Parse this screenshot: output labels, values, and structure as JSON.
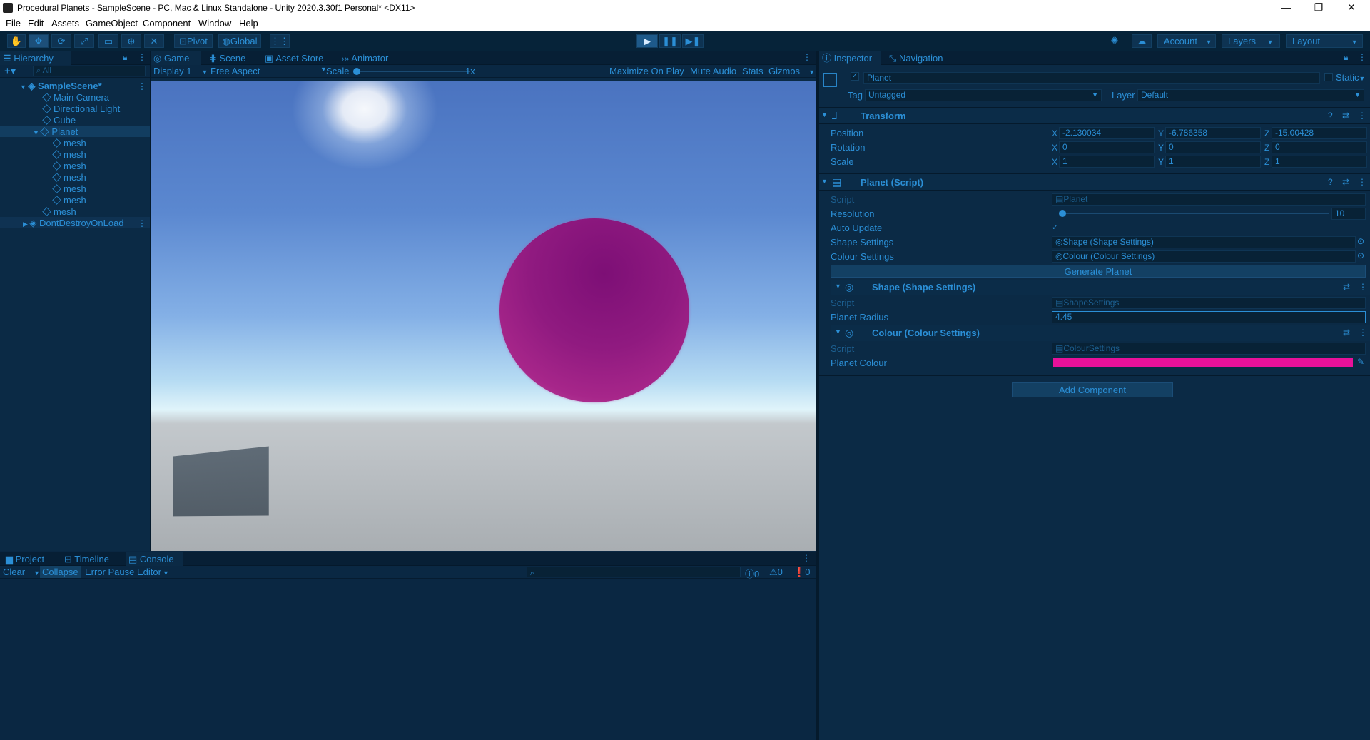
{
  "window": {
    "title": "Procedural Planets - SampleScene - PC, Mac & Linux Standalone - Unity 2020.3.30f1 Personal* <DX11>",
    "minimize": "—",
    "maximize": "❐",
    "close": "✕"
  },
  "menu": [
    "File",
    "Edit",
    "Assets",
    "GameObject",
    "Component",
    "Window",
    "Help"
  ],
  "toolbar": {
    "pivot": "Pivot",
    "global": "Global",
    "account": "Account",
    "layers": "Layers",
    "layout": "Layout"
  },
  "hierarchy": {
    "tab": "Hierarchy",
    "search_placeholder": "All",
    "scene": "SampleScene*",
    "items": [
      "Main Camera",
      "Directional Light",
      "Cube",
      "Planet",
      "mesh",
      "mesh",
      "mesh",
      "mesh",
      "mesh",
      "mesh",
      "mesh",
      "DontDestroyOnLoad"
    ]
  },
  "game": {
    "tabs": [
      "Game",
      "Scene",
      "Asset Store",
      "Animator"
    ],
    "display": "Display 1",
    "aspect": "Free Aspect",
    "scale_label": "Scale",
    "scale_value": "1x",
    "maximize": "Maximize On Play",
    "mute": "Mute Audio",
    "stats": "Stats",
    "gizmos": "Gizmos"
  },
  "console": {
    "tabs": [
      "Project",
      "Timeline",
      "Console"
    ],
    "clear": "Clear",
    "collapse": "Collapse",
    "error_pause": "Error Pause",
    "editor": "Editor",
    "counts": [
      "0",
      "0",
      "0"
    ]
  },
  "inspector": {
    "tabs": [
      "Inspector",
      "Navigation"
    ],
    "object_name": "Planet",
    "static": "Static",
    "tag_label": "Tag",
    "tag": "Untagged",
    "layer_label": "Layer",
    "layer": "Default",
    "transform": {
      "title": "Transform",
      "position_label": "Position",
      "rotation_label": "Rotation",
      "scale_label": "Scale",
      "position": [
        "-2.130034",
        "-6.786358",
        "-15.00428"
      ],
      "rotation": [
        "0",
        "0",
        "0"
      ],
      "scale": [
        "1",
        "1",
        "1"
      ],
      "axes": [
        "X",
        "Y",
        "Z"
      ]
    },
    "planet_script": {
      "title": "Planet (Script)",
      "script_label": "Script",
      "script_value": "Planet",
      "resolution_label": "Resolution",
      "resolution": "10",
      "resolution_fraction": 0.0,
      "auto_update_label": "Auto Update",
      "auto_update_check": "✓",
      "shape_label": "Shape Settings",
      "shape_value": "Shape (Shape Settings)",
      "colour_label": "Colour Settings",
      "colour_value": "Colour (Colour Settings)",
      "generate": "Generate Planet"
    },
    "shape_settings": {
      "title": "Shape (Shape Settings)",
      "script_label": "Script",
      "script_value": "ShapeSettings",
      "radius_label": "Planet Radius",
      "radius": "4.45"
    },
    "colour_settings": {
      "title": "Colour (Colour Settings)",
      "script_label": "Script",
      "script_value": "ColourSettings",
      "colour_label": "Planet Colour",
      "colour_hex": "#e8119a"
    },
    "add_component": "Add Component"
  },
  "colors": {
    "accent": "#2b8fd6",
    "planet": "#b01f8a"
  }
}
